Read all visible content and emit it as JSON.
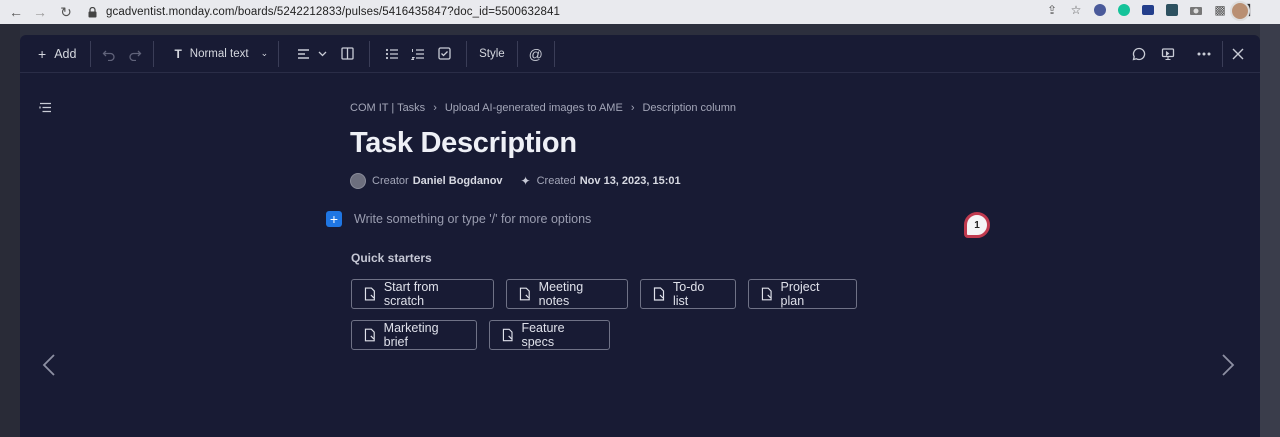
{
  "browser": {
    "url": "gcadventist.monday.com/boards/5242212833/pulses/5416435847?doc_id=5500632841",
    "extensions": [
      "share-icon",
      "star-icon",
      "grammarly-icon",
      "green-ext-icon",
      "id-ext-icon",
      "app-ext-icon",
      "camera-icon",
      "puzzle-icon",
      "sidebar-icon"
    ]
  },
  "toolbar": {
    "add_label": "Add",
    "text_style_label": "Normal text",
    "style_label": "Style"
  },
  "doc": {
    "breadcrumb": [
      "COM IT | Tasks",
      "Upload AI-generated images to AME",
      "Description column"
    ],
    "title": "Task Description",
    "creator_label": "Creator",
    "creator_name": "Daniel Bogdanov",
    "created_label": "Created",
    "created_date": "Nov 13, 2023, 15:01",
    "placeholder": "Write something or type '/' for more options",
    "comment_count": "1"
  },
  "quick_starters": {
    "label": "Quick starters",
    "items": [
      "Start from scratch",
      "Meeting notes",
      "To-do list",
      "Project plan",
      "Marketing brief",
      "Feature specs"
    ]
  },
  "colors": {
    "modal_bg": "#181b34",
    "accent_blue": "#1f76e3",
    "badge_border": "#c03a4f"
  }
}
